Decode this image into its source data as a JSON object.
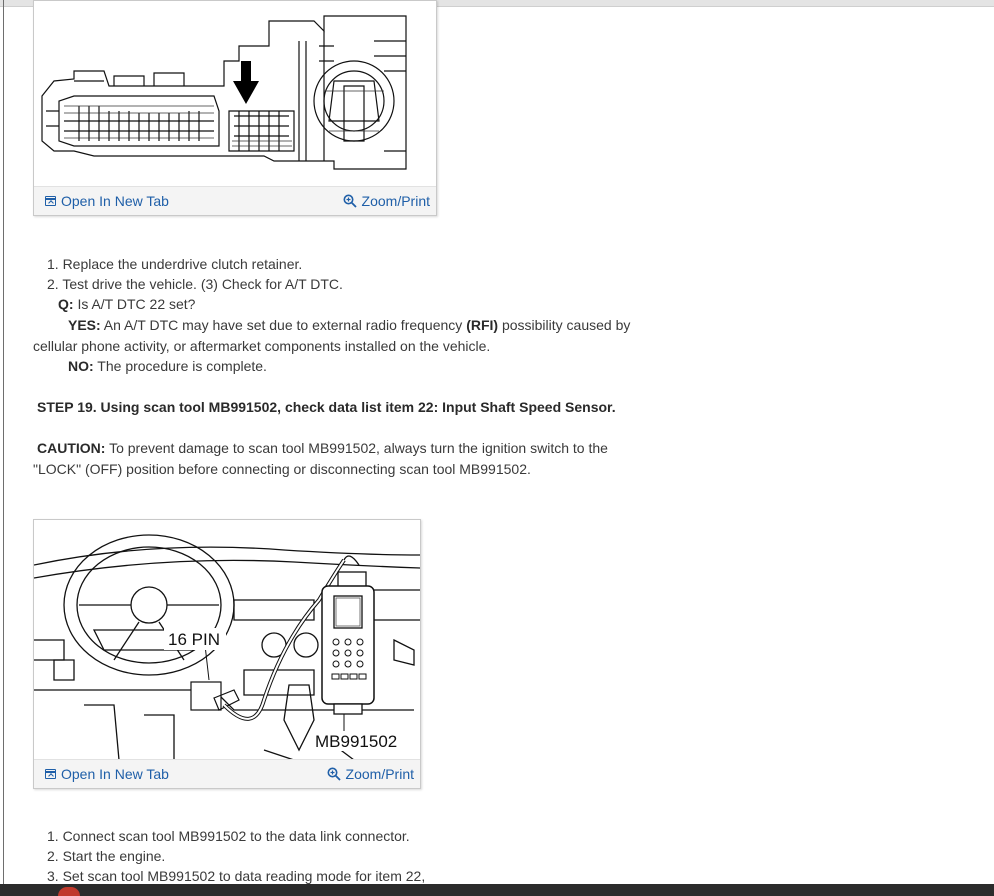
{
  "figure1": {
    "open_tab": "Open In New Tab",
    "zoom": "Zoom/Print"
  },
  "list1": [
    "1. Replace the underdrive clutch retainer.",
    "2. Test drive the vehicle. (3) Check for A/T DTC."
  ],
  "question": {
    "label": "Q:",
    "text": " Is A/T DTC 22 set?"
  },
  "yes": {
    "label": "YES:",
    "text_a": " An A/T DTC may have set due to external radio frequency ",
    "rfi": "(RFI)",
    "text_b": " possibility caused by",
    "line2": "cellular phone activity, or aftermarket components installed on the vehicle."
  },
  "no": {
    "label": "NO:",
    "text": " The procedure is complete."
  },
  "step": "STEP 19. Using scan tool MB991502, check data list item 22: Input Shaft Speed Sensor.",
  "caution": {
    "label": "CAUTION:",
    "text": " To prevent damage to scan tool MB991502, always turn the ignition switch to the",
    "line2": "\"LOCK\" (OFF) position before connecting or disconnecting scan tool MB991502."
  },
  "figure2": {
    "pin_label": "16 PIN",
    "tool_label": "MB991502",
    "open_tab": "Open In New Tab",
    "zoom": "Zoom/Print"
  },
  "list2": [
    "1. Connect scan tool MB991502 to the data link connector.",
    "2. Start the engine.",
    "3. Set scan tool MB991502 to data reading mode for item 22,"
  ],
  "colors": {
    "link": "#1f5fa8",
    "text": "#3a3a3a"
  }
}
